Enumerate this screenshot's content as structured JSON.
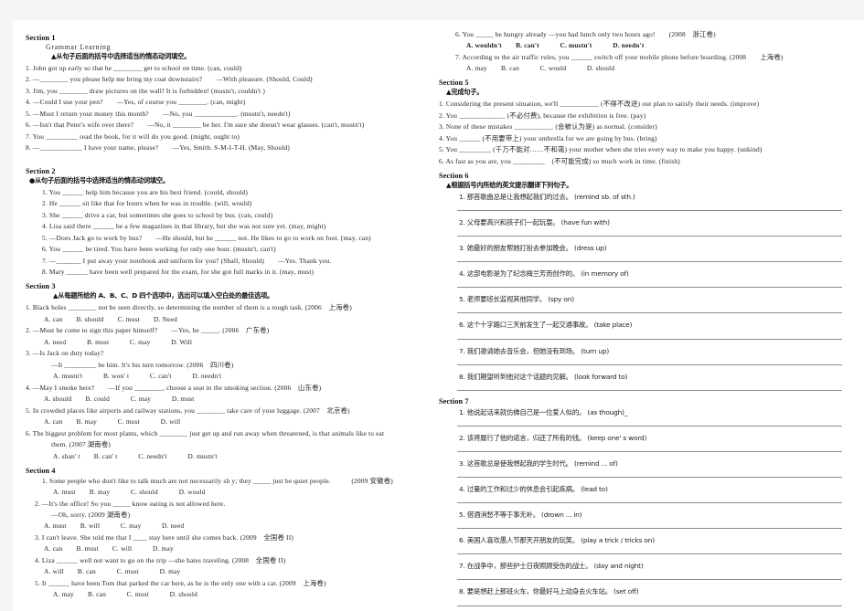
{
  "document": {
    "title": "Grammar Learning — Modal Verbs Worksheet"
  },
  "sections": {
    "s1": {
      "head": "Section 1",
      "subtitle": "Grammar  Learning",
      "instruction": "▲从句子后面的括号中选择适当的情态动词填空。",
      "items": [
        "1. John got up early so that he ________ get to school on time. (can, could)",
        "2. —________ you please help me bring my coat downstairs?　　—With pleasure. (Should, Could)",
        "3. Jim, you ________ draw pictures on the wall! It is forbidden! (mustn't, couldn't )",
        "4. —Could I use your pen?　　—Yes, of course you ________. (can, might)",
        "5. —Must I return your money this month?　　—No, you ____________. (mustn't, needn't)",
        "6. —Isn't that Peter's wife over there?　　—No, it ________ be her. I'm sure she doesn't wear glasses. (can't, mustn't)",
        "7. You _________ read the book, for it will do you good. (might, ought to)",
        "8. —____________ I have your name, please?　　—Yes, Smith. S-M-I-T-H. (May, Should)"
      ]
    },
    "s2": {
      "head": "Section 2",
      "instruction": "●从句子后面的括号中选择适当的情态动词填空。",
      "items": [
        "1. You ______ help him because you are his best friend. (could, should)",
        "2. He ______ sit like that for hours when he was in trouble. (will, would)",
        "3. She ______ drive a car, but sometimes she goes to school by bus. (can, could)",
        "4. Lisa said there ______ be a few magazines in that library, but she was not sure yet. (may, might)",
        "5. —Does Jack go to work by bus?　　—He should, but he ______ not. He likes to go to work on foot. (may, can)",
        "6. You ______ be tired. You have been working for only one hour. (mustn't, can't)",
        "7. —_______ I put away your notebook and uniform for you? (Shall, Should)　　—Yes. Thank you.",
        "8. Mary ______ have been well prepared for the exam, for she got full marks in it. (may, must)"
      ]
    },
    "s3": {
      "head": "Section 3",
      "instruction": "▲从每题所给的 A、B、C、D 四个选项中，选出可以填入空白处的最佳选项。",
      "items": [
        {
          "q": "1. Black holes ________ not be seen directly, so determining the number of them is a tough task. (2006　上海卷)",
          "opts": "A. can　　B. should　　C. must　　D. Need"
        },
        {
          "q": "2. —Must he come to sign this paper himself?　　—Yes, he _____. (2006　广东卷)",
          "opts": "A. need　　　B. must　　　C. may　　　D. Will"
        },
        {
          "q": "3. —Is Jack on duty today?",
          "cont": "—It _________ be him. It's his turn tomorrow. (2006　四川卷)",
          "opts": "A. mustn't　　　B. won' t　　　C. can't　　　D. needn't"
        },
        {
          "q": "4. —May I smoke here?　　—If you ________, choose a seat in the smoking section. (2006　山东卷)",
          "opts": "A. should　　B. could　　　C. may　　　D. must"
        },
        {
          "q": "5. In crowded places like airports and railway stations, you ________ take care of your luggage. (2007　北京卷)",
          "opts": "A. can　　B. may　　　C. must　　　D. will"
        },
        {
          "q": "6. The biggest problem for most plants, which ________ just get up and run away when threatened, is that animals like to eat",
          "cont": "them. (2007 湖南卷)",
          "opts": "A. shan' t　　B. can' t　　　C. needn't　　　D. mustn't"
        }
      ]
    },
    "s4": {
      "head": "Section 4",
      "items": [
        {
          "q": "1. Some people who don't like to talk much are not necessarily sh y; they _____ just be quiet people.　　　(2009 安徽卷)",
          "opts": "A. must　　B. may　　　C. should　　　D. would"
        },
        {
          "q": "2. —It's the office! So you _____ know eating is not allowed here.",
          "cont": "—Oh, sorry. (2009 湖南卷)",
          "opts": "A. must　　B. will　　　C. may　　　D. need"
        },
        {
          "q": "3. I can't leave. She told me that I ____ stay here until she comes back. (2009　全国卷 II)",
          "opts": "A. can　　B. must　　C. will　　　D. may"
        },
        {
          "q": "4. Liza ______ well not want to go on the trip —she hates traveling. (2008　全国卷 II)",
          "opts": "A. will　　B. can　　　C. must　　　D. may"
        },
        {
          "q": "5. It ______ have been Tom that parked the car here, as he is the only one with a car. (2009　上海卷)",
          "opts": "A. may　　B. can　　　C. must　　　D. should"
        },
        {
          "q": "6. You _____ be hungry already —you had lunch only two hours ago!　　(2008　浙江卷)",
          "opts": "A. wouldn't　　B. can't　　　C. mustn't　　　D. needn't"
        },
        {
          "q": "7. According to the air traffic rules, you ______ switch off your mobile phone before boarding. (2008　　上海卷)",
          "opts": "A. may　　B. can　　　C. would　　　D. should"
        }
      ]
    },
    "s5": {
      "head": "Section 5",
      "instruction": "▲完成句子。",
      "items": [
        "1. Considering the present situation, we'll ___________ (不得不改进) our plan to satisfy their needs. (improve)",
        "2. You _____________ (不必付费), because the exhibition is free. (pay)",
        "3. None of these mistakes ___________ (会被认为是) as normal. (consider)",
        "4. You ______ (不用要带上) your umbrella for we are going by bus. (bring)",
        "5. You _________ (千万不能对……不和蔼) your mother when she tries every way to make you happy. (unkind)",
        "6. As fast as you are, you _________　(不可能完成) so much work in time. (finish)"
      ]
    },
    "s6": {
      "head": "Section 6",
      "instruction": "▲根据括号内所给的英文提示翻译下列句子。",
      "items": [
        "1. 那首歌曲总是让我想起我们的过去。 (remind sb. of sth.)",
        "2. 父母要高兴和孩子们一起玩耍。 (have fun with)",
        "3. 她最好的朋友帮她打扮去参加晚会。 (dress up)",
        "4. 这部电影是为了纪念梅兰芳而创作的。 (in memory of)",
        "5. 老师要班长监视其他同学。 (spy on)",
        "6. 这个十字路口三天前发生了一起交通事故。 (take place)",
        "7. 我们邀请她去音乐会，但她没有到场。 (turn up)",
        "8. 我们期望听到他对这个话题的见解。 (look forward to)"
      ]
    },
    "s7": {
      "head": "Section 7",
      "items": [
        "1. 他说起话来就仿佛自己是一位爱人似的。 (as though)_",
        "2. 该将履行了他的诺言，归还了所有的钱。 (keep one' s word)",
        "3. 这首歌总是使我想起我的学生时代。 (remind ... of)",
        "4. 过量的工作和过少的休息会引起疾病。 (lead to)",
        "5. 借酒消愁不等于事无补。 (drown ... in)",
        "6. 美国人喜欢愚人节那天开朋友的玩笑。 (play a trick / tricks on)",
        "7. 在战争中，那些护士日夜照顾受伤的战士。 (day and night)",
        "8. 要是想赶上那班火车，你最好马上动身去火车站。 (set off)"
      ]
    }
  }
}
